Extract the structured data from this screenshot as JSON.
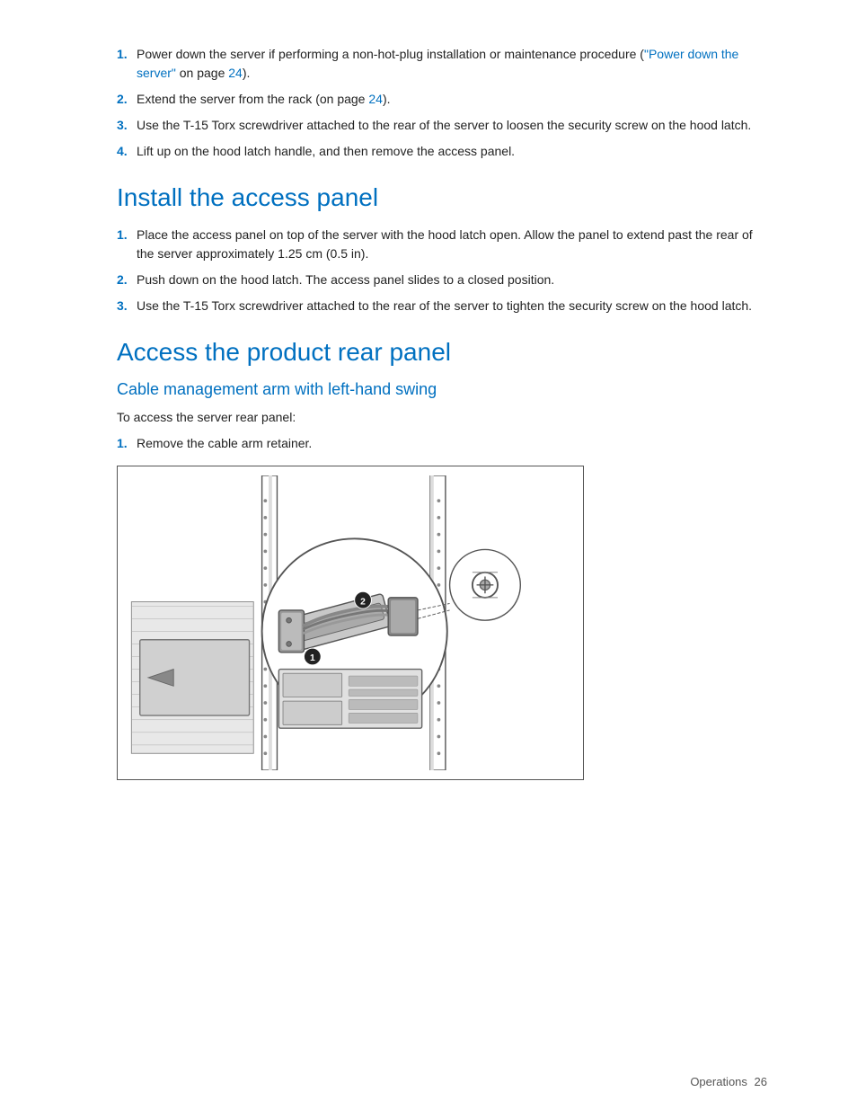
{
  "page": {
    "footer": {
      "section_label": "Operations",
      "page_number": "26"
    }
  },
  "remove_access_panel_steps": {
    "step1": {
      "num": "1.",
      "text": "Power down the server if performing a non-hot-plug installation or maintenance procedure (",
      "link_text": "\"Power down the server\"",
      "link_suffix": " on page ",
      "link_page": "24",
      "suffix": ")."
    },
    "step2": {
      "num": "2.",
      "text": "Extend the server from the rack (on page ",
      "link_page": "24",
      "suffix": ")."
    },
    "step3": {
      "num": "3.",
      "text": "Use the T-15 Torx screwdriver attached to the rear of the server to loosen the security screw on the hood latch."
    },
    "step4": {
      "num": "4.",
      "text": "Lift up on the hood latch handle, and then remove the access panel."
    }
  },
  "install_access_panel": {
    "heading": "Install the access panel",
    "steps": [
      {
        "num": "1.",
        "text": "Place the access panel on top of the server with the hood latch open. Allow the panel to extend past the rear of the server approximately 1.25 cm (0.5 in)."
      },
      {
        "num": "2.",
        "text": "Push down on the hood latch. The access panel slides to a closed position."
      },
      {
        "num": "3.",
        "text": "Use the T-15 Torx screwdriver attached to the rear of the server to tighten the security screw on the hood latch."
      }
    ]
  },
  "access_rear_panel": {
    "heading": "Access the product rear panel",
    "sub_heading": "Cable management arm with left-hand swing",
    "intro": "To access the server rear panel:",
    "steps": [
      {
        "num": "1.",
        "text": "Remove the cable arm retainer."
      }
    ]
  }
}
